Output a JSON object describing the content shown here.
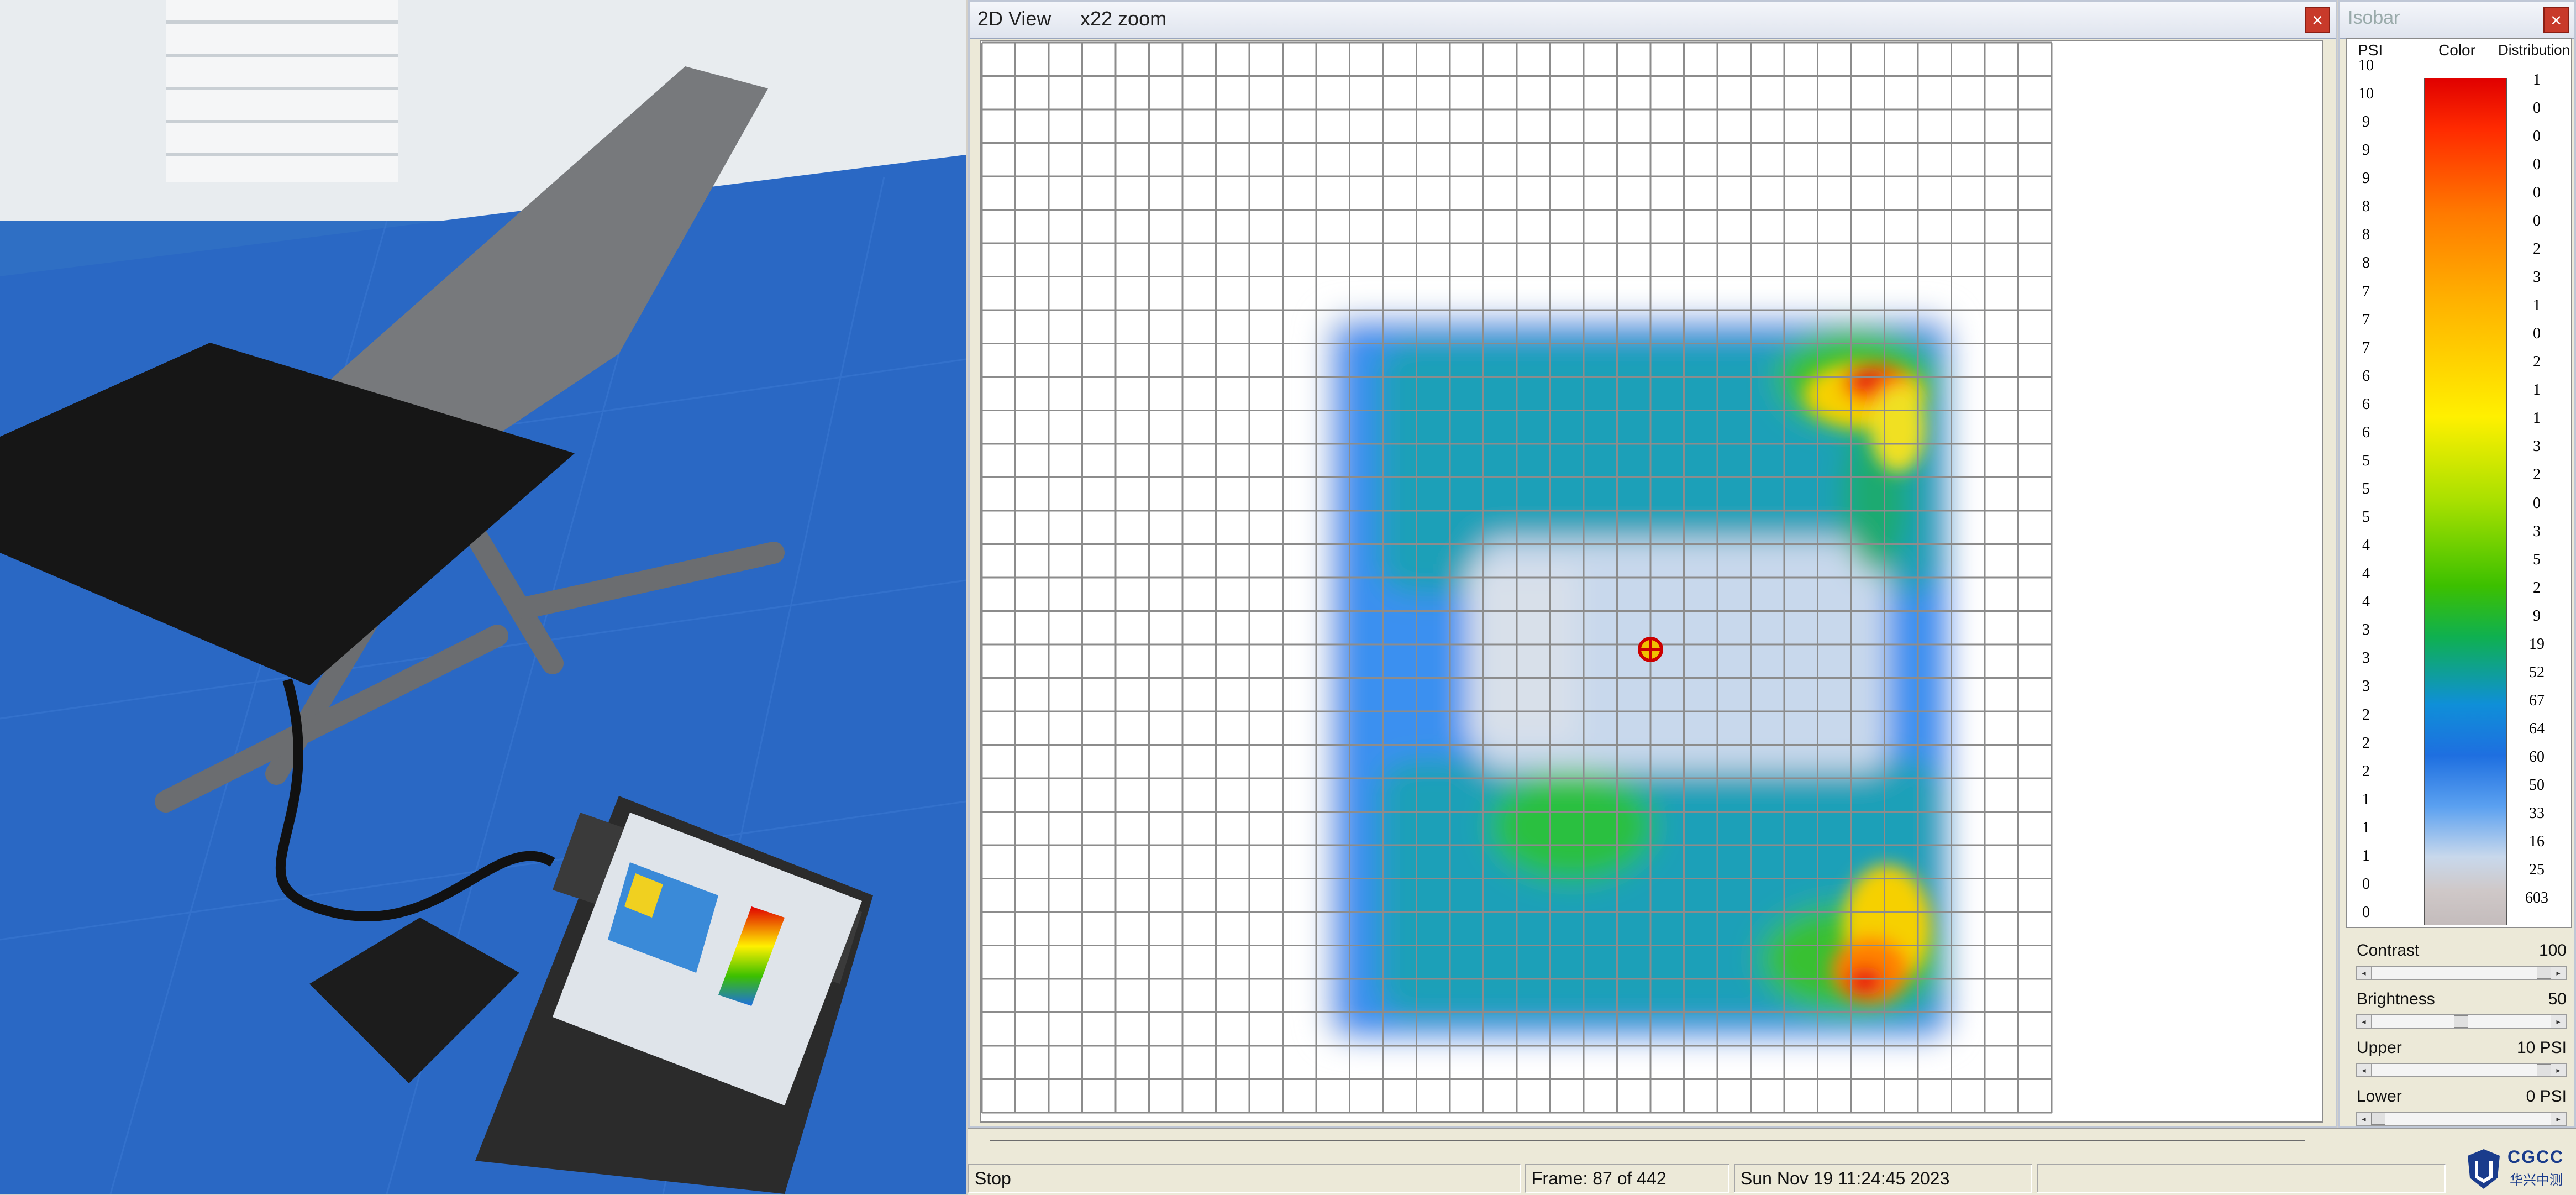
{
  "colors": {
    "high": "#e00000",
    "mid_high": "#ffb000",
    "mid": "#fff000",
    "mid_low": "#3cc000",
    "low": "#1e6fe0",
    "lowest": "#c4bcbc",
    "close_button": "#c83a2a"
  },
  "view2d": {
    "title": "2D View",
    "zoom": "x22 zoom",
    "close_icon": "close-icon",
    "grid_columns": 32,
    "grid_rows": 32
  },
  "isobar": {
    "title": "Isobar",
    "close_icon": "close-icon",
    "headers": {
      "psi": "PSI",
      "color": "Color",
      "distribution": "Distribution"
    },
    "psi_values": [
      "10",
      "10",
      "9",
      "9",
      "9",
      "8",
      "8",
      "8",
      "7",
      "7",
      "7",
      "6",
      "6",
      "6",
      "5",
      "5",
      "5",
      "4",
      "4",
      "4",
      "3",
      "3",
      "3",
      "2",
      "2",
      "2",
      "1",
      "1",
      "1",
      "0",
      "0"
    ],
    "distribution_values": [
      "1",
      "0",
      "0",
      "0",
      "0",
      "0",
      "2",
      "3",
      "1",
      "0",
      "2",
      "1",
      "1",
      "3",
      "2",
      "0",
      "3",
      "5",
      "2",
      "9",
      "19",
      "52",
      "67",
      "64",
      "60",
      "50",
      "33",
      "16",
      "25",
      "603"
    ]
  },
  "controls": {
    "contrast": {
      "label": "Contrast",
      "value": "100",
      "level": 1.0
    },
    "brightness": {
      "label": "Brightness",
      "value": "50",
      "level": 0.5
    },
    "upper": {
      "label": "Upper",
      "value": "10 PSI",
      "level": 1.0
    },
    "lower": {
      "label": "Lower",
      "value": "0 PSI",
      "level": 0.0
    }
  },
  "status": {
    "state": "Stop",
    "frame": "Frame: 87 of 442",
    "timestamp": "Sun Nov 19 11:24:45 2023"
  },
  "logo": {
    "text": "CGCC",
    "sub": "华兴中测"
  }
}
